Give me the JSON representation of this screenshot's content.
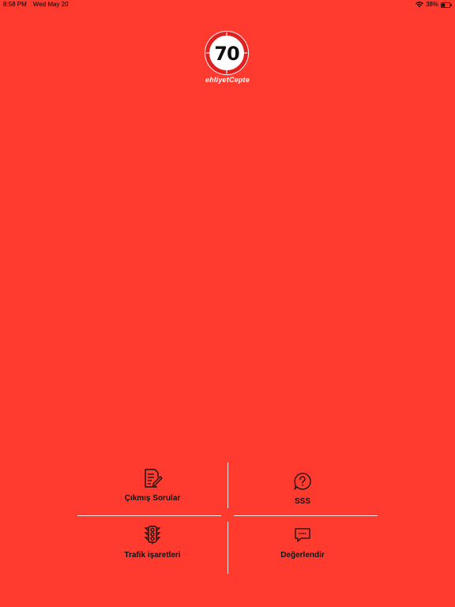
{
  "status_bar": {
    "time": "8:58 PM",
    "date": "Wed May 20",
    "battery": "38%",
    "battery_level": 0.38
  },
  "logo": {
    "speed": "70",
    "brand": "ehliyetCepte"
  },
  "menu": {
    "items": [
      {
        "label": "Çıkmış Sorular",
        "icon": "document-edit-icon"
      },
      {
        "label": "SSS",
        "icon": "question-bubble-icon"
      },
      {
        "label": "Trafik işaretleri",
        "icon": "traffic-light-icon"
      },
      {
        "label": "Değerlendir",
        "icon": "chat-bubble-icon"
      }
    ]
  },
  "colors": {
    "background": "#FF3B30",
    "sign_border": "#E02020",
    "divider": "#FFFFFF"
  }
}
